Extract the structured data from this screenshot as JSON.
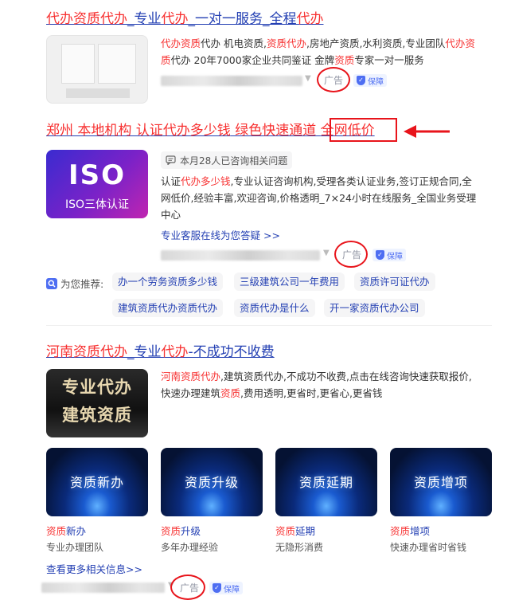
{
  "result1": {
    "title_parts": [
      "代办资质",
      "代办",
      "_专业",
      "代办",
      "_一对一服务_全程",
      "代办"
    ],
    "desc_line1": [
      "代办资质",
      "代办 机电资质,",
      "资质代办",
      ",房地产资质,水利资质,专业团队",
      "代办资"
    ],
    "desc_line2": [
      "质",
      "代办 20年7000家企业共同鉴证 金牌",
      "资质",
      "专家一对一服务"
    ],
    "ad_label": "广告",
    "guarantee_label": "保障"
  },
  "result2": {
    "title_parts": [
      "郑州 本地机构 认证",
      "代办多少钱",
      " 绿色快速通道 ",
      "全网低价"
    ],
    "consult_count": "本月28人已咨询相关问题",
    "thumb_big": "ISO",
    "thumb_sub": "ISO三体认证",
    "desc_line1": [
      "认证",
      "代办多少钱",
      ",专业认证咨询机构,受理各类认证业务,签订正规合同,全"
    ],
    "desc_line2": "网低价,经验丰富,欢迎咨询,价格透明_7×24小时在线服务_全国业务受理",
    "desc_line3": "中心",
    "service_link": "专业客服在线为您答疑 >>",
    "ad_label": "广告",
    "guarantee_label": "保障"
  },
  "recommend": {
    "label": "为您推荐:",
    "chips": [
      "办一个劳务资质多少钱",
      "三级建筑公司一年费用",
      "资质许可证代办",
      "建筑资质代办资质代办",
      "资质代办是什么",
      "开一家资质代办公司"
    ]
  },
  "result3": {
    "title_parts": [
      "河南",
      "资质代办",
      "_专业",
      "代办",
      "-不成功不收费"
    ],
    "thumb_text": [
      "专业代办",
      "建筑资质"
    ],
    "desc_line1": [
      "河南资质代办",
      ",建筑资质代办,不成功不收费,点击在线咨询快速获取报价,"
    ],
    "desc_line2": [
      "快速办理建筑",
      "资质",
      ",费用透明,更省时,更省心,更省钱"
    ],
    "tiles": [
      {
        "image_text": "资质新办",
        "caption_hl": "资质",
        "caption_rest": "新办",
        "sub": "专业办理团队"
      },
      {
        "image_text": "资质升级",
        "caption_hl": "资质",
        "caption_rest": "升级",
        "sub": "多年办理经验"
      },
      {
        "image_text": "资质延期",
        "caption_hl": "资质",
        "caption_rest": "延期",
        "sub": "无隐形消费"
      },
      {
        "image_text": "资质增项",
        "caption_hl": "资质",
        "caption_rest": "增项",
        "sub": "快速办理省时省钱"
      }
    ],
    "more_link": "查看更多相关信息>>",
    "ad_label": "广告",
    "guarantee_label": "保障"
  },
  "colors": {
    "link_blue": "#2440b3",
    "highlight_red": "#f73131",
    "annotation_red": "#e8141b",
    "muted": "#9195a3"
  }
}
